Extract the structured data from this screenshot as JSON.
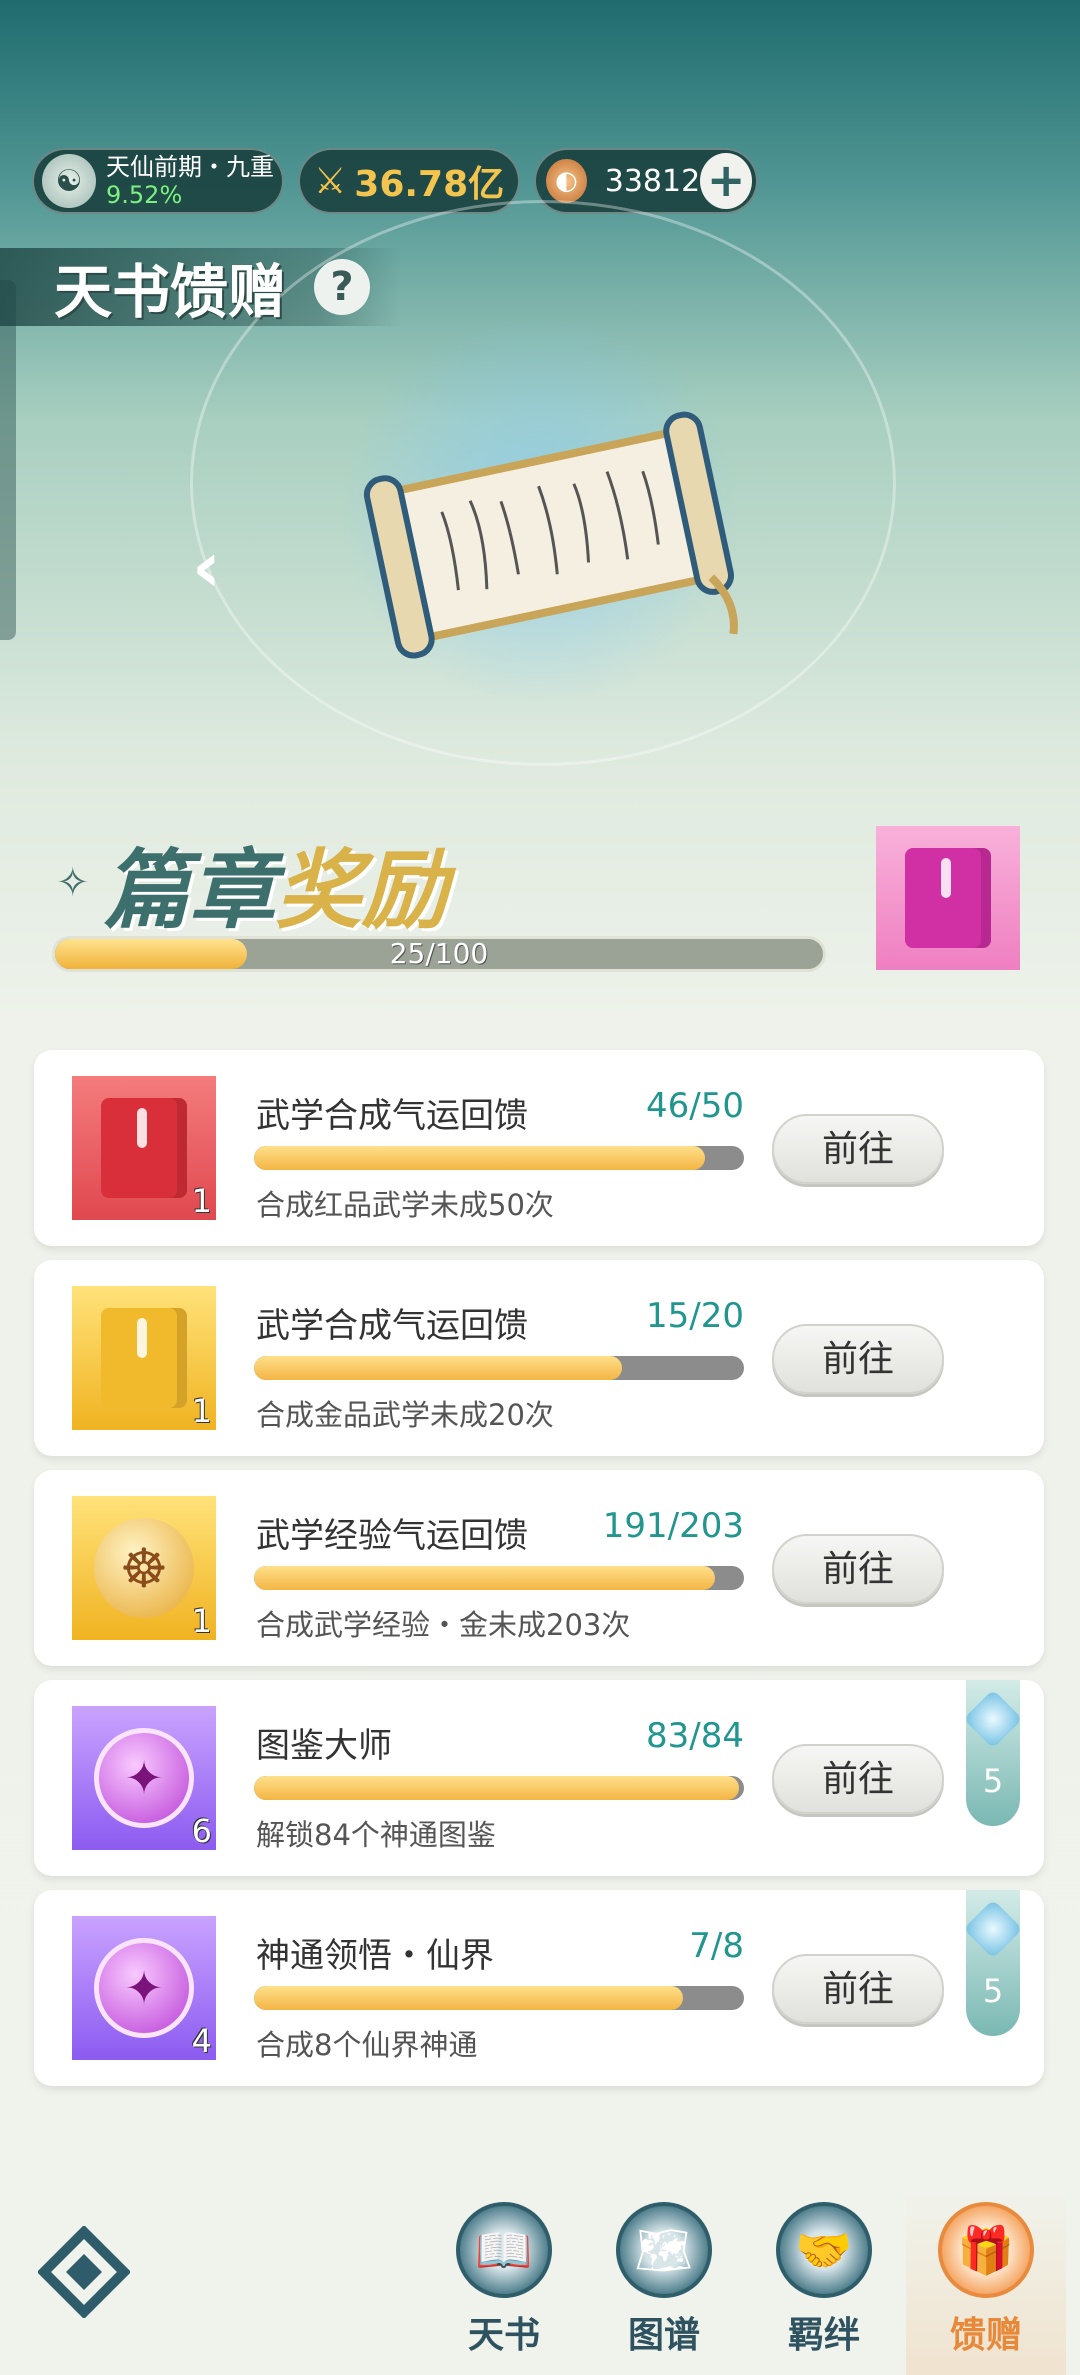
{
  "status": {
    "realm_name": "天仙前期・九重",
    "realm_progress": "9.52%",
    "power": "36.78亿",
    "currency": "33812",
    "plus_symbol": "+"
  },
  "header": {
    "title": "天书馈赠",
    "help_symbol": "?",
    "prev_symbol": "‹"
  },
  "chapter": {
    "title_part1": "篇章",
    "title_part2": "奖励",
    "star_symbol": "✧",
    "progress_label": "25/100",
    "progress_fraction": 0.25
  },
  "tasks": [
    {
      "name": "武学合成气运回馈",
      "progress": "46/50",
      "fraction": 0.92,
      "desc": "合成红品武学未成50次",
      "icon": "red-book-icon",
      "count": "1",
      "button": "前往"
    },
    {
      "name": "武学合成气运回馈",
      "progress": "15/20",
      "fraction": 0.75,
      "desc": "合成金品武学未成20次",
      "icon": "gold-book-icon",
      "count": "1",
      "button": "前往"
    },
    {
      "name": "武学经验气运回馈",
      "progress": "191/203",
      "fraction": 0.94,
      "desc": "合成武学经验・金未成203次",
      "icon": "gold-orb-icon",
      "count": "1",
      "button": "前往"
    },
    {
      "name": "图鉴大师",
      "progress": "83/84",
      "fraction": 0.99,
      "desc": "解锁84个神通图鉴",
      "icon": "purple-orb-icon",
      "count": "6",
      "button": "前往",
      "bonus": "5"
    },
    {
      "name": "神通领悟・仙界",
      "progress": "7/8",
      "fraction": 0.875,
      "desc": "合成8个仙界神通",
      "icon": "purple-orb-icon",
      "count": "4",
      "button": "前往",
      "bonus": "5"
    }
  ],
  "nav": {
    "tab1": "天书",
    "tab2": "图谱",
    "tab3": "羁绊",
    "tab4": "馈赠",
    "active": "馈赠"
  }
}
